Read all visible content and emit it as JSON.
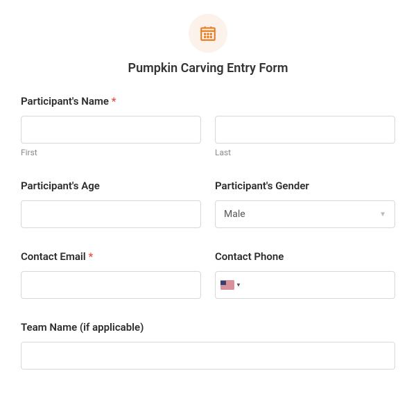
{
  "header": {
    "title": "Pumpkin Carving Entry Form"
  },
  "fields": {
    "name": {
      "label": "Participant's Name",
      "required": "*",
      "first_sub": "First",
      "last_sub": "Last"
    },
    "age": {
      "label": "Participant's Age"
    },
    "gender": {
      "label": "Participant's Gender",
      "selected": "Male"
    },
    "email": {
      "label": "Contact Email",
      "required": "*"
    },
    "phone": {
      "label": "Contact Phone"
    },
    "team": {
      "label": "Team Name (if applicable)"
    }
  }
}
